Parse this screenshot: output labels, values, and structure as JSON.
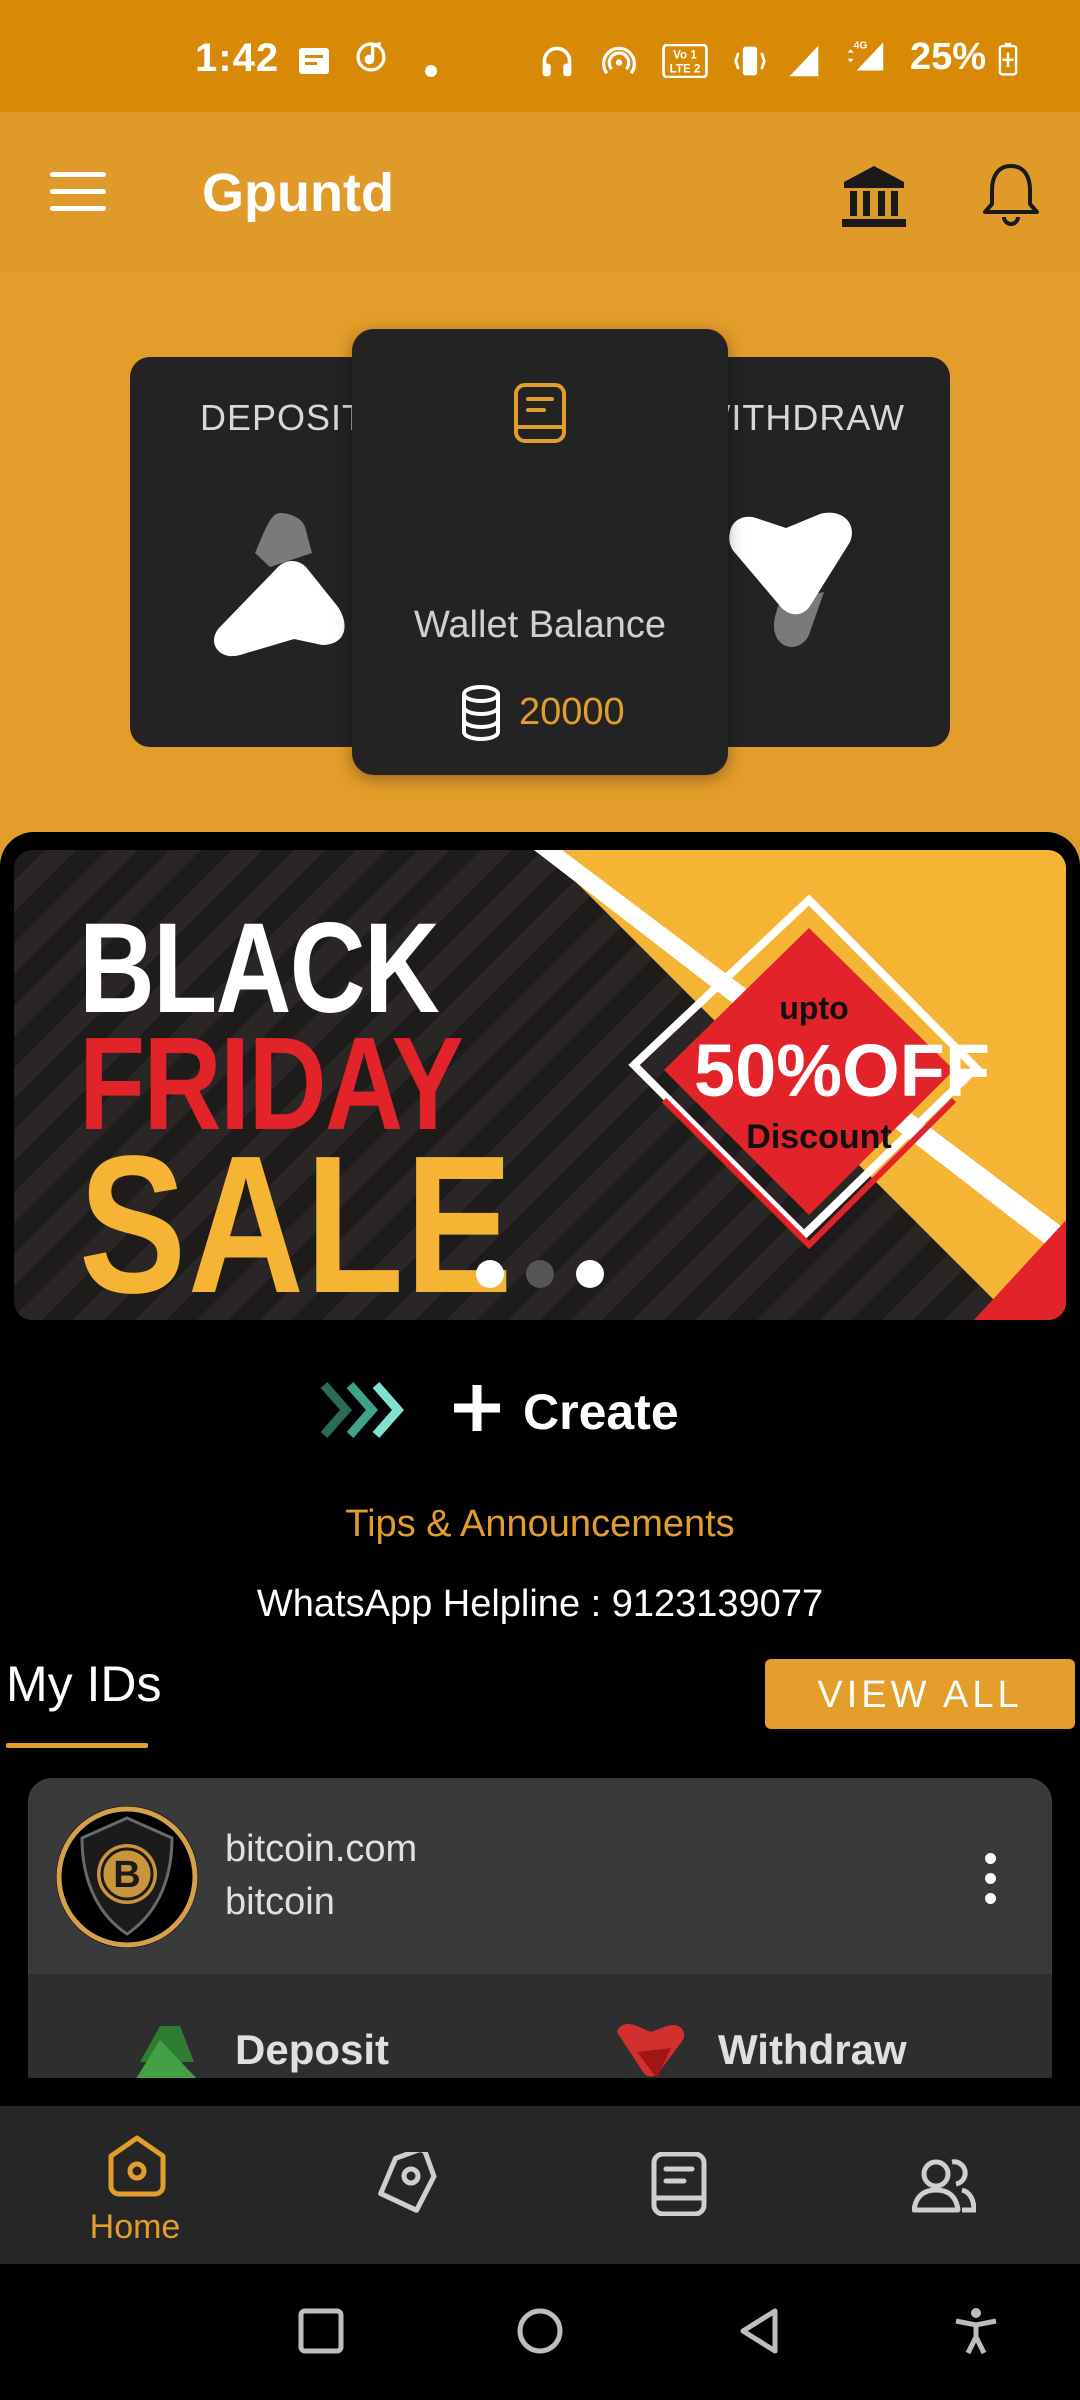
{
  "status_bar": {
    "time": "1:42",
    "battery": "25%",
    "icons": [
      "message-icon",
      "music-icon",
      "dot-icon",
      "headphones-icon",
      "hotspot-icon",
      "volte-icon",
      "vibrate-icon",
      "signal-icon",
      "4g-signal-icon",
      "battery-charging-icon"
    ]
  },
  "header": {
    "title": "Gpuntd",
    "icons": [
      "menu-icon",
      "bank-icon",
      "bell-icon"
    ]
  },
  "hero": {
    "deposit_label": "DEPOSIT",
    "withdraw_label": "WITHDRAW",
    "wallet_label": "Wallet Balance",
    "wallet_amount": "20000"
  },
  "banner": {
    "line1": "BLACK",
    "line2": "FRIDAY",
    "line3": "SALE",
    "upto": "upto",
    "percent": "50%OFF",
    "discount": "Discount",
    "slides": 3,
    "active_slide": 0
  },
  "create": {
    "label": "Create"
  },
  "tips": {
    "title": "Tips & Announcements"
  },
  "helpline": {
    "text": "WhatsApp Helpline : 9123139077"
  },
  "my_ids": {
    "title": "My IDs",
    "view_all": "VIEW ALL",
    "items": [
      {
        "site": "bitcoin.com",
        "name": "bitcoin",
        "deposit_label": "Deposit",
        "withdraw_label": "Withdraw"
      }
    ]
  },
  "bottom_nav": [
    {
      "label": "Home",
      "icon": "home-icon",
      "active": true
    },
    {
      "label": "",
      "icon": "tag-icon",
      "active": false
    },
    {
      "label": "",
      "icon": "passbook-icon",
      "active": false
    },
    {
      "label": "",
      "icon": "users-icon",
      "active": false
    }
  ],
  "colors": {
    "accent": "#E39D2B",
    "status_bar": "#D88A07",
    "card_bg": "#232323",
    "nav_bg": "#262626"
  }
}
